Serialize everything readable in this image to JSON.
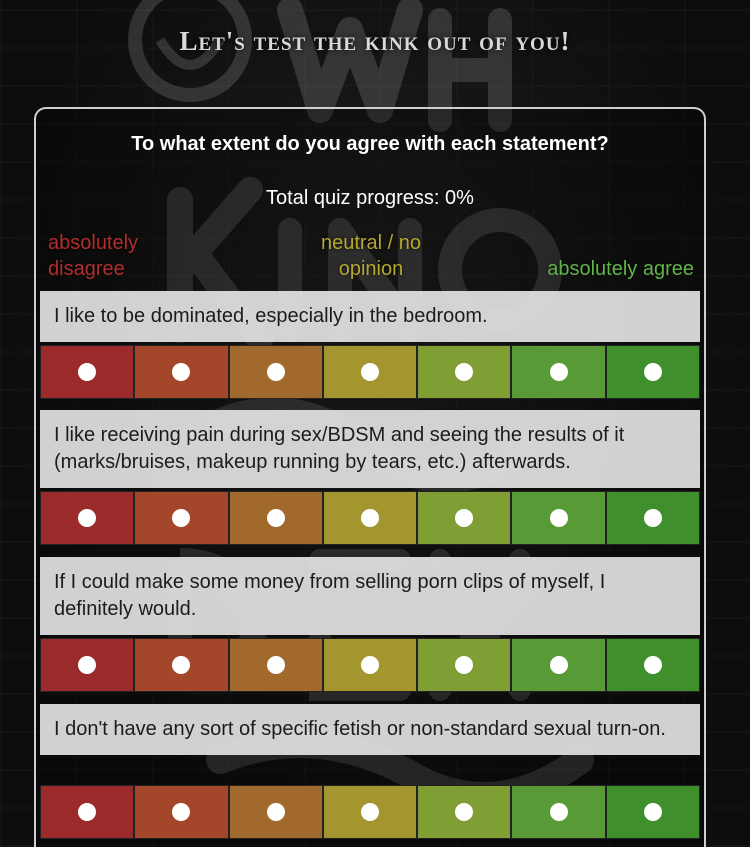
{
  "header": {
    "title": "Let's test the kink out of you!"
  },
  "quiz": {
    "prompt": "To what extent do you agree with each statement?",
    "progress_label": "Total quiz progress: 0%",
    "progress_percent": 0,
    "scale": {
      "left": "absolutely disagree",
      "middle": "neutral / no opinion",
      "right": "absolutely agree"
    },
    "option_colors": [
      "#9b2a2a",
      "#a3462a",
      "#a16a2c",
      "#a3962e",
      "#7f9e34",
      "#589a35",
      "#3f8f2c"
    ],
    "selected": [
      null,
      null,
      null,
      null
    ],
    "questions": [
      {
        "text": "I like to be dominated, especially in the bedroom."
      },
      {
        "text": "I like receiving pain during sex/BDSM and seeing the results of it (marks/bruises, makeup running by tears, etc.) afterwards."
      },
      {
        "text": "If I could make some money from selling porn clips of myself, I definitely would."
      },
      {
        "text": "I don't have any sort of specific fetish or non-standard sexual turn-on."
      }
    ]
  }
}
